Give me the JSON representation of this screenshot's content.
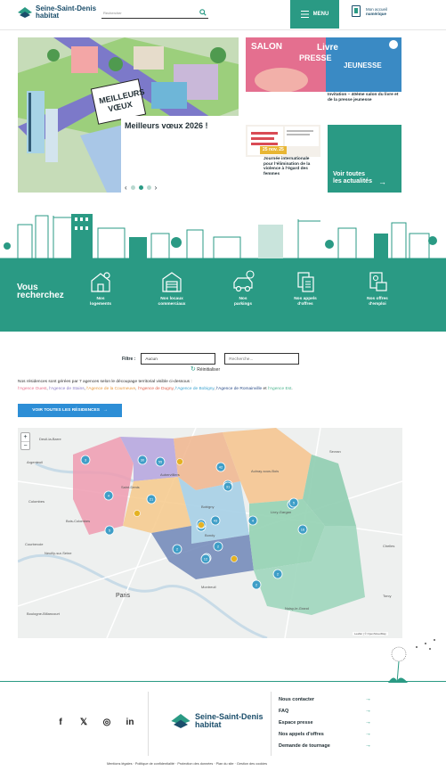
{
  "header": {
    "brand_line1": "Seine-Saint-Denis",
    "brand_line2": "habitat",
    "search_placeholder": "Rechercher",
    "menu_label": "MENU",
    "account_line1": "Mon accueil",
    "account_line2": "numérique"
  },
  "hero": {
    "title": "Meilleurs vœux 2026 !",
    "poster_word1": "MEILLEURS",
    "poster_word2": "VŒUX",
    "poster_word3": "2026",
    "prev": "‹",
    "next": "›"
  },
  "news": [
    {
      "text": "Invitation – 40ème salon du livre et de la presse jeunesse",
      "poster_line1": "SALON",
      "poster_line2": "Livre",
      "poster_line3": "PRESSE",
      "poster_line4": "JEUNESSE"
    },
    {
      "text": "Journée internationale pour l’élimination de la violence à l’égard des femmes",
      "badge": "25 nov. 25"
    }
  ],
  "all_news": {
    "line1": "Voir toutes",
    "line2": "les actualités",
    "arrow": "→"
  },
  "search_band": {
    "line1": "Vous",
    "line2": "recherchez",
    "categories": [
      {
        "line1": "Nos",
        "line2": "logements",
        "icon": "housing-icon"
      },
      {
        "line1": "Nos locaux",
        "line2": "commerciaux",
        "icon": "shop-icon"
      },
      {
        "line1": "Nos",
        "line2": "parkings",
        "icon": "car-icon"
      },
      {
        "line1": "Nos appels",
        "line2": "d'offres",
        "icon": "document-icon"
      },
      {
        "line1": "Nos offres",
        "line2": "d'emploi",
        "icon": "job-icon"
      }
    ]
  },
  "filters": {
    "label": "Filtre :",
    "select_value": "Aucun",
    "search_placeholder": "Recherche...",
    "reset": "Réinitialiser"
  },
  "agencies": {
    "intro": "Nos résidences sont gérées par 7 agences selon le découpage territorial visible ci-dessous :",
    "items": [
      {
        "name": "l'Agence Ouest",
        "color": "#e9718d"
      },
      {
        "name": "l'Agence de Stains",
        "color": "#8c7cc6"
      },
      {
        "name": "l'Agence de la Courneuve",
        "color": "#e79a3f"
      },
      {
        "name": "l'Agence de Dugny",
        "color": "#e0614c"
      },
      {
        "name": "l'Agence de Bobigny",
        "color": "#3ba3d0"
      },
      {
        "name": "l'Agence de Romainville",
        "color": "#2d4f8a"
      },
      {
        "name": "l'Agence Est",
        "color": "#4db58f"
      }
    ],
    "sep_comma": ", ",
    "sep_and": " et ",
    "end": "."
  },
  "button_all": {
    "label": "VOIR TOUTES LES RÉSIDENCES",
    "arrow": "→"
  },
  "map": {
    "zoom_in": "+",
    "zoom_out": "−",
    "attribution": "Leaflet | © OpenStreetMap",
    "places": [
      "Deuil-la-Barre",
      "Argenteuil",
      "Saint-Denis",
      "Colombes",
      "Bois-Colombes",
      "Courbevoie",
      "Neuilly-sur-Seine",
      "Paris",
      "Boulogne-Billancourt",
      "Aubervilliers",
      "Bobigny",
      "Bondy",
      "Aulnay-sous-Bois",
      "Livry-Gargan",
      "Montreuil",
      "Noisy-le-Grand",
      "Chelles",
      "Torcy",
      "Sevran"
    ],
    "markers": [
      "3",
      "30",
      "55",
      "4",
      "5",
      "21",
      "42",
      "17",
      "4",
      "2",
      "43",
      "2",
      "5",
      "2",
      "12",
      "26",
      "31",
      "2",
      "4",
      "5",
      "16",
      "2"
    ]
  },
  "footer": {
    "social": [
      "f",
      "𝕏",
      "◎",
      "in"
    ],
    "brand_line1": "Seine-Saint-Denis",
    "brand_line2": "habitat",
    "links": [
      "Nous contacter",
      "FAQ",
      "Espace presse",
      "Nos appels d'offres",
      "Demande de tournage"
    ],
    "link_arrow": "→",
    "legal": [
      "Mentions légales",
      "Politique de confidentialité",
      "Protection des données",
      "Plan du site",
      "Gestion des cookies"
    ],
    "legal_sep": " · "
  },
  "colors": {
    "brand_teal": "#2a9a84",
    "brand_navy": "#1b4e6b",
    "button_blue": "#2d8ed6",
    "marker_teal": "#3f9ec7",
    "marker_yellow": "#e4b222"
  }
}
